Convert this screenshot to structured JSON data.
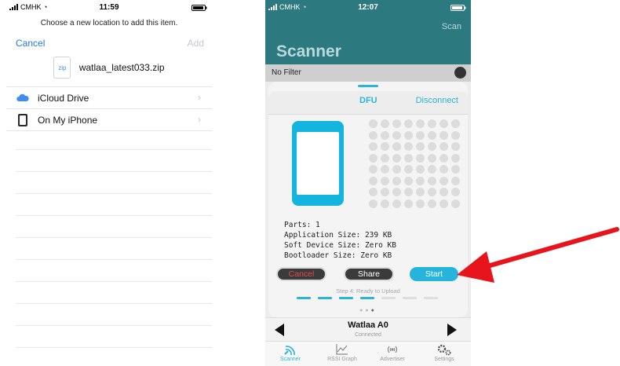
{
  "left_phone": {
    "status_bar": {
      "carrier": "CMHK",
      "time": "11:59"
    },
    "prompt": "Choose a new location to add this item.",
    "cancel_label": "Cancel",
    "add_label": "Add",
    "file": {
      "icon_text": "zip",
      "name": "watlaa_latest033.zip"
    },
    "locations": [
      {
        "label": "iCloud Drive",
        "icon": "icloud-icon"
      },
      {
        "label": "On My iPhone",
        "icon": "iphone-icon"
      }
    ]
  },
  "right_phone": {
    "status_bar": {
      "carrier": "CMHK",
      "time": "12:07"
    },
    "scan_label": "Scan",
    "title": "Scanner",
    "filter_label": "No Filter",
    "tabs": {
      "active": "DFU",
      "disconnect": "Disconnect"
    },
    "info_lines": [
      "Parts: 1",
      "Application Size: 239 KB",
      "Soft Device Size: Zero KB",
      "Bootloader Size: Zero KB"
    ],
    "buttons": {
      "cancel": "Cancel",
      "share": "Share",
      "start": "Start"
    },
    "step_text": "Step 4: Ready to Upload",
    "progress_steps": {
      "total": 7,
      "done": 4
    },
    "device": {
      "name": "Watlaa A0",
      "status": "Connected"
    },
    "tab_bar": [
      {
        "label": "Scanner",
        "icon": "scanner-icon",
        "active": true
      },
      {
        "label": "RSSI Graph",
        "icon": "rssi-graph-icon",
        "active": false
      },
      {
        "label": "Advertiser",
        "icon": "advertiser-icon",
        "active": false
      },
      {
        "label": "Settings",
        "icon": "settings-icon",
        "active": false
      }
    ],
    "colors": {
      "header_teal": "#2c7a80",
      "accent": "#2bb5d6",
      "cancel_red": "#e04a4a"
    }
  },
  "annotation": {
    "arrow_color": "#e8141b"
  }
}
